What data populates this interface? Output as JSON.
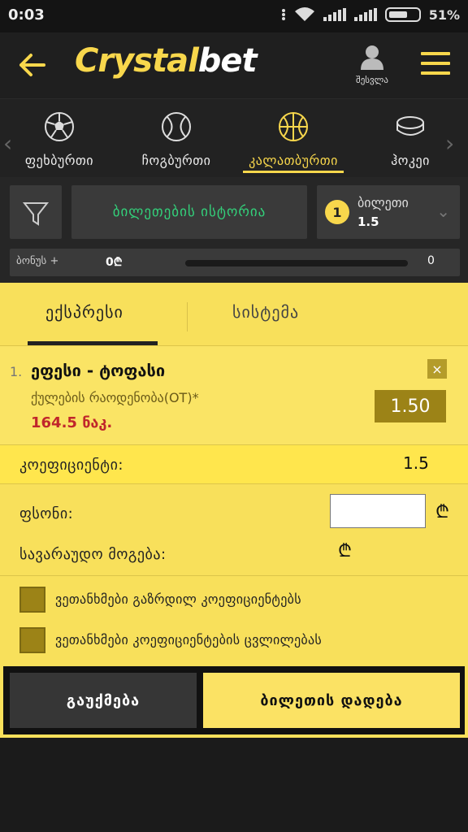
{
  "status": {
    "time": "0:03",
    "battery": "51%"
  },
  "header": {
    "logo_part1": "Crystal",
    "logo_part2": "bet",
    "user_label": "შესვლა"
  },
  "sports": [
    {
      "label": "ფეხბურთი",
      "icon": "soccer-ball-icon"
    },
    {
      "label": "ჩოგბურთი",
      "icon": "tennis-ball-icon"
    },
    {
      "label": "კალათბურთი",
      "icon": "basketball-icon",
      "active": true
    },
    {
      "label": "ჰოკეი",
      "icon": "hockey-puck-icon"
    }
  ],
  "toolbar": {
    "history_label": "ბილეთების ისტორია",
    "ticket_count": "1",
    "ticket_label": "ბილეთი",
    "ticket_odds": "1.5"
  },
  "bonus": {
    "label": "ბონუს +",
    "value": "0₾",
    "count": "0"
  },
  "tabs": {
    "express": "ექსპრესი",
    "system": "სისტემა"
  },
  "bet": {
    "index": "1.",
    "match": "ეფესი - ტოფასი",
    "market": "ქულების რაოდენობა(OT)*",
    "pick": "164.5 ნაკ.",
    "odds": "1.50",
    "close": "×"
  },
  "summary": {
    "coef_label": "კოეფიციენტი:",
    "coef_value": "1.5",
    "stake_label": "ფსონი:",
    "win_label": "სავარაუდო მოგება:",
    "currency": "₾"
  },
  "options": [
    {
      "label": "ვეთანხმები გაზრდილ კოეფიციენტებს"
    },
    {
      "label": "ვეთანხმები კოეფიციენტების ცვლილებას"
    }
  ],
  "actions": {
    "cancel": "გაუქმება",
    "place": "ბილეთის დადება"
  },
  "colors": {
    "accent": "#f8d74c",
    "panel": "#f8e05b",
    "history": "#33d07a",
    "pick": "#c0262b"
  }
}
